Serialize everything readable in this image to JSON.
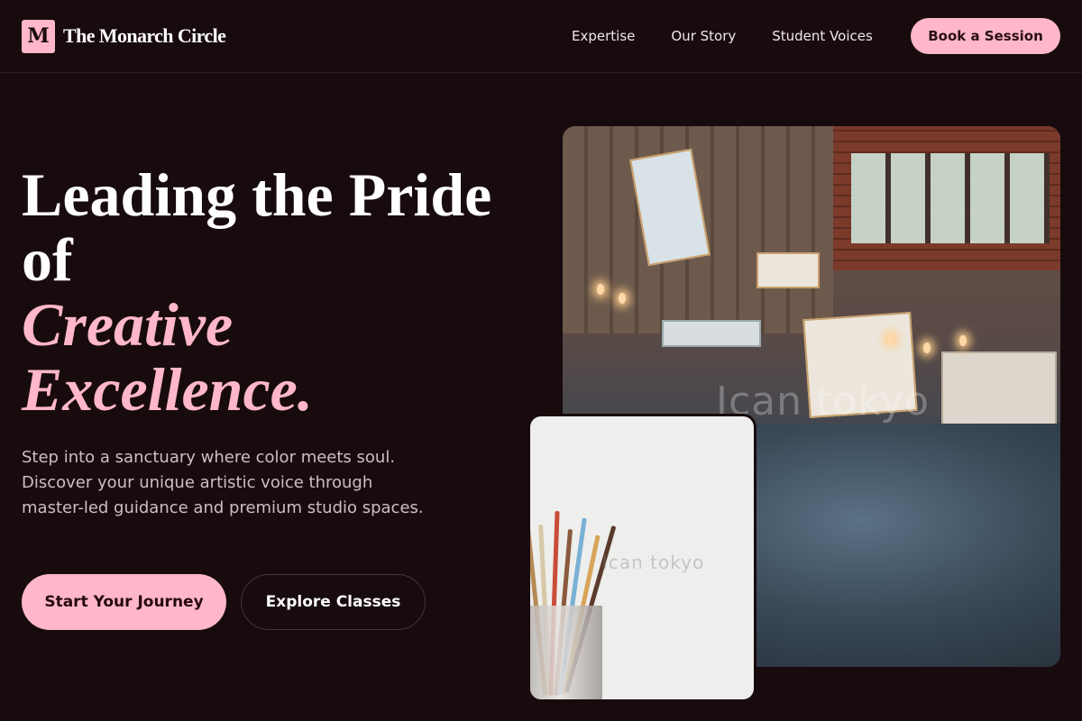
{
  "brand": {
    "logo_letter": "M",
    "name": "The Monarch Circle"
  },
  "nav": {
    "links": [
      "Expertise",
      "Our Story",
      "Student Voices"
    ],
    "cta": "Book a Session"
  },
  "hero": {
    "headline_line1": "Leading the Pride",
    "headline_line2": "of",
    "headline_accent1": "Creative",
    "headline_accent2": "Excellence.",
    "lede": "Step into a sanctuary where color meets soul. Discover your unique artistic voice through master-led guidance and premium studio spaces.",
    "primary_button": "Start Your Journey",
    "secondary_button": "Explore Classes"
  },
  "images": {
    "studio_watermark": "Ican tokyo",
    "brushes_watermark": "Ican tokyo"
  },
  "colors": {
    "background": "#180b0e",
    "accent": "#ffb7c9",
    "text": "#ffffff"
  }
}
